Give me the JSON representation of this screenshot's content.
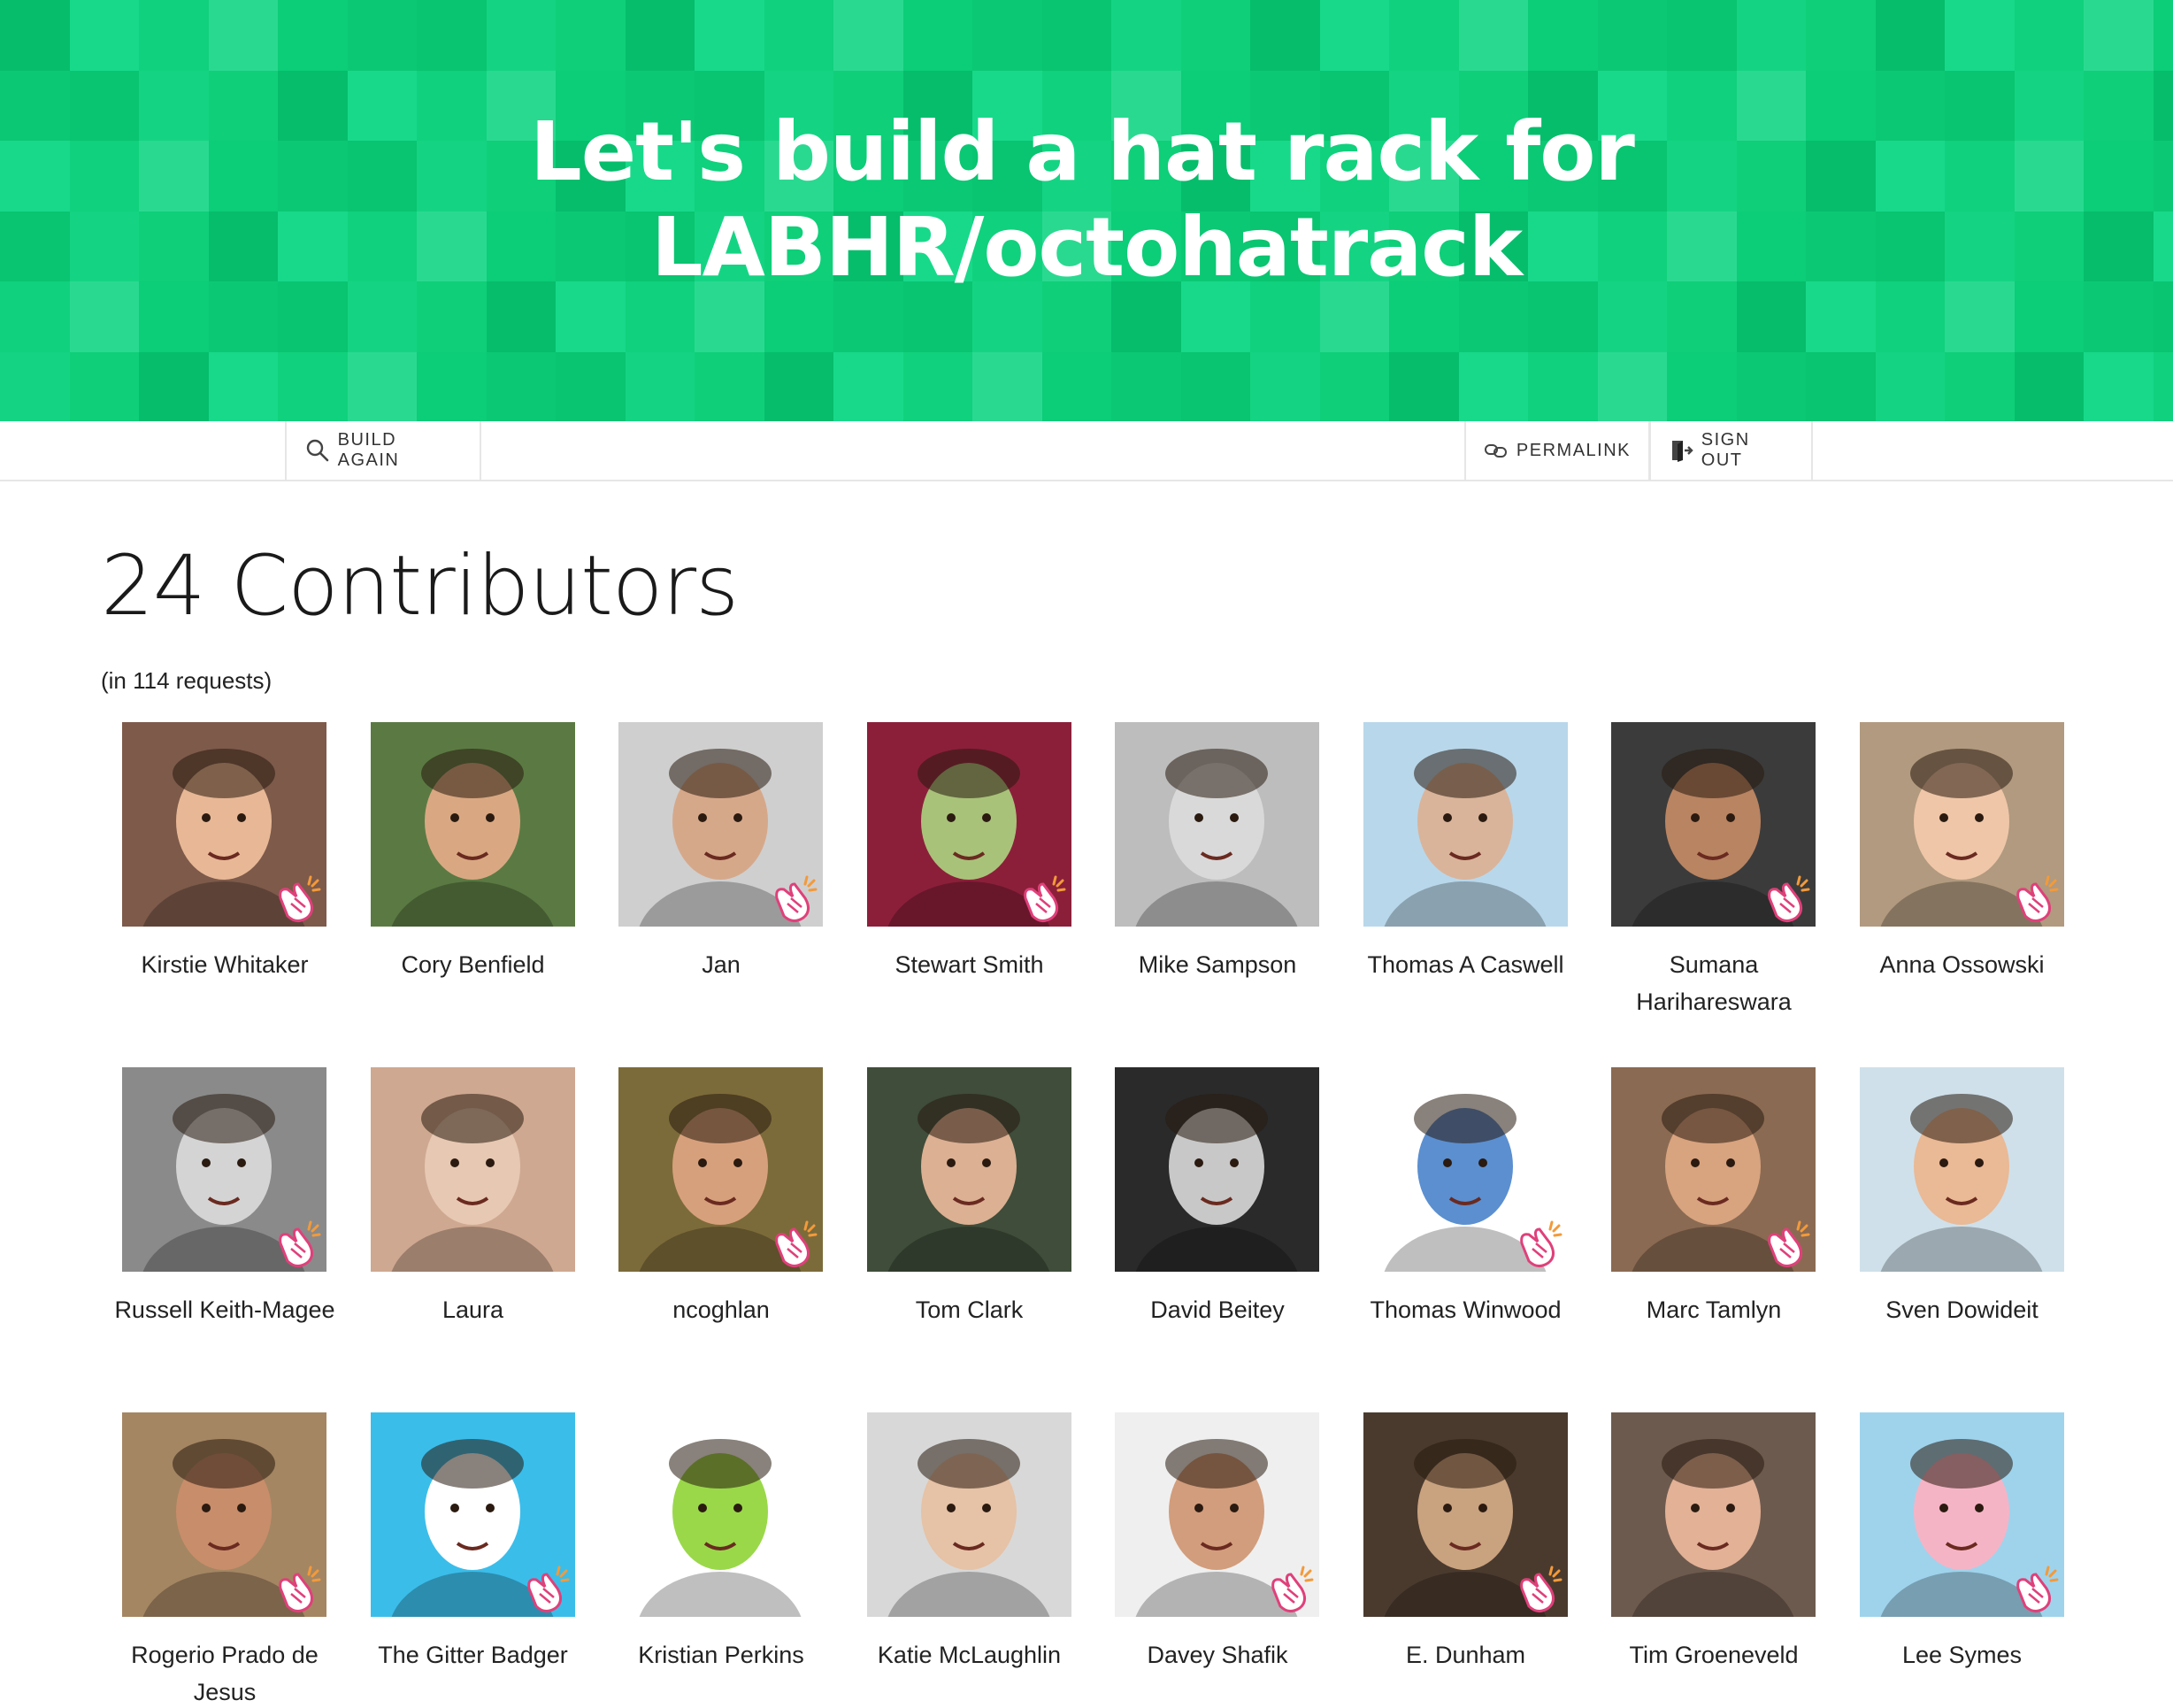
{
  "header": {
    "title_line1": "Let's build a hat rack for",
    "title_line2": "LABHR/octohatrack",
    "color": "#0ccd78"
  },
  "nav": {
    "build_again": "BUILD AGAIN",
    "permalink": "PERMALINK",
    "sign_out": "SIGN OUT",
    "icons": [
      "search-icon",
      "link-icon",
      "sign-out-icon"
    ]
  },
  "summary": {
    "heading": "24 Contributors",
    "requests": "(in 114 requests)"
  },
  "contributors": [
    {
      "name": "Kirstie Whitaker",
      "bg": "#7d5a4a",
      "face": "#e8b896",
      "clap": true
    },
    {
      "name": "Cory Benfield",
      "bg": "#5b7a43",
      "face": "#d9a882",
      "clap": false
    },
    {
      "name": "Jan",
      "bg": "#cfcfcf",
      "face": "#d6a88a",
      "clap": true
    },
    {
      "name": "Stewart Smith",
      "bg": "#8b1f3a",
      "face": "#a9c27a",
      "clap": true
    },
    {
      "name": "Mike Sampson",
      "bg": "#bdbdbd",
      "face": "#d9d9d9",
      "clap": false
    },
    {
      "name": "Thomas A Caswell",
      "bg": "#b9d7ea",
      "face": "#d9b49a",
      "clap": false
    },
    {
      "name": "Sumana Harihareswara",
      "bg": "#3b3b3b",
      "face": "#b98462",
      "clap": true
    },
    {
      "name": "Anna Ossowski",
      "bg": "#b19a7f",
      "face": "#efc6a8",
      "clap": true
    },
    {
      "name": "Russell Keith-Magee",
      "bg": "#8a8a8a",
      "face": "#d4d4d4",
      "clap": true
    },
    {
      "name": "Laura",
      "bg": "#cfa891",
      "face": "#e7c8b2",
      "clap": false
    },
    {
      "name": "ncoghlan",
      "bg": "#7c6b3a",
      "face": "#d7a07c",
      "clap": true
    },
    {
      "name": "Tom Clark",
      "bg": "#3f4d3a",
      "face": "#dcb093",
      "clap": false
    },
    {
      "name": "David Beitey",
      "bg": "#2a2a2a",
      "face": "#c8c8c8",
      "clap": false
    },
    {
      "name": "Thomas Winwood",
      "bg": "#ffffff",
      "face": "#5b8fd0",
      "clap": true
    },
    {
      "name": "Marc Tamlyn",
      "bg": "#8a6a52",
      "face": "#d8a37f",
      "clap": true
    },
    {
      "name": "Sven Dowideit",
      "bg": "#cfe0ea",
      "face": "#eab995",
      "clap": false
    },
    {
      "name": "Rogerio Prado de Jesus",
      "bg": "#a48663",
      "face": "#c88d6a",
      "clap": true
    },
    {
      "name": "The Gitter Badger",
      "bg": "#3bbdea",
      "face": "#ffffff",
      "clap": true
    },
    {
      "name": "Kristian Perkins",
      "bg": "#ffffff",
      "face": "#9ad84a",
      "clap": false
    },
    {
      "name": "Katie McLaughlin",
      "bg": "#d8d8d8",
      "face": "#e6c2a6",
      "clap": false
    },
    {
      "name": "Davey Shafik",
      "bg": "#efefef",
      "face": "#d29d7c",
      "clap": true
    },
    {
      "name": "E. Dunham",
      "bg": "#4a3a2e",
      "face": "#c9a27f",
      "clap": true
    },
    {
      "name": "Tim Groeneveld",
      "bg": "#6d5a4e",
      "face": "#e2b196",
      "clap": false
    },
    {
      "name": "Lee Symes",
      "bg": "#9fd3ec",
      "face": "#f5b4c5",
      "clap": true
    }
  ]
}
